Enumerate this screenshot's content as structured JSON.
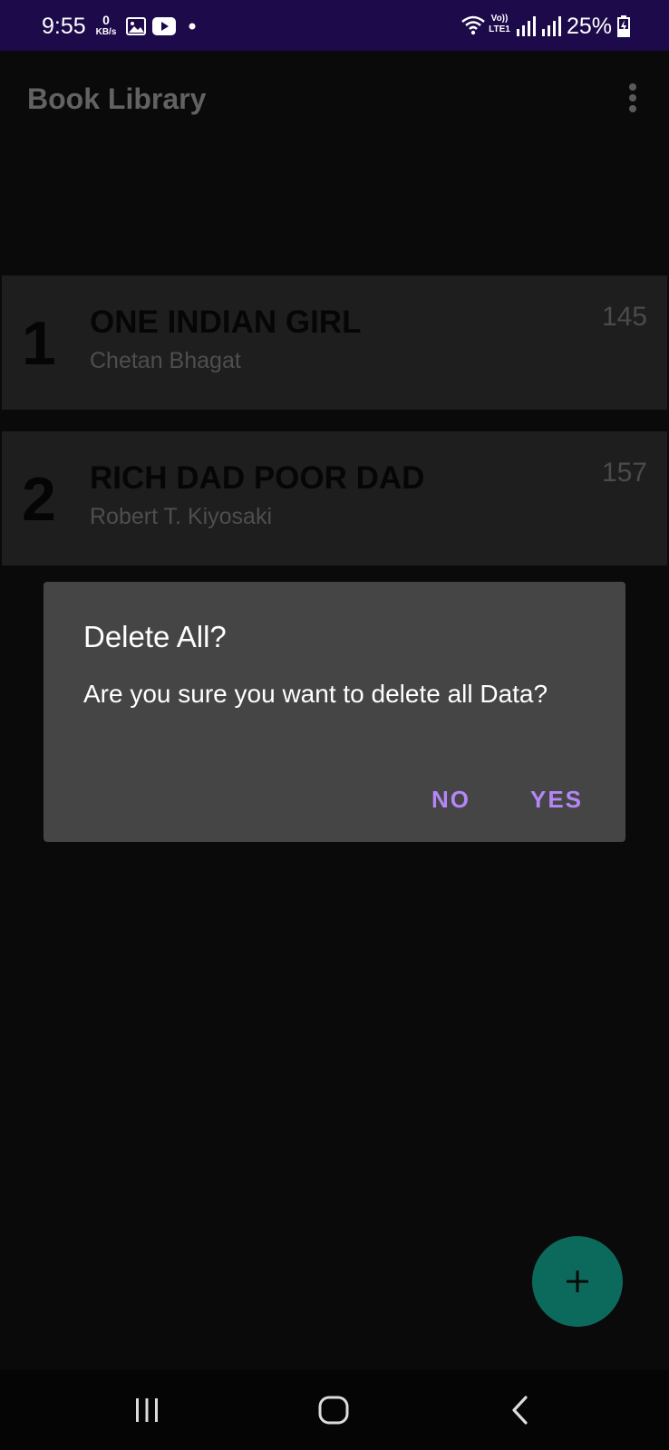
{
  "status_bar": {
    "time": "9:55",
    "network_speed_value": "0",
    "network_speed_unit": "KB/s",
    "network_label_top": "Vo))",
    "network_label_bottom": "LTE1",
    "battery": "25%",
    "icons": [
      "gallery-icon",
      "youtube-icon",
      "notification-dot-icon",
      "wifi-icon",
      "signal-icon",
      "battery-charging-icon"
    ]
  },
  "app_bar": {
    "title": "Book Library",
    "menu_icon": "more-vert-icon"
  },
  "books": [
    {
      "number": "1",
      "title": "ONE INDIAN GIRL",
      "author": "Chetan Bhagat",
      "pages": "145"
    },
    {
      "number": "2",
      "title": "RICH DAD POOR DAD",
      "author": "Robert T. Kiyosaki",
      "pages": "157"
    }
  ],
  "dialog": {
    "title": "Delete All?",
    "message": "Are you sure you want to delete all Data?",
    "negative_button": "NO",
    "positive_button": "YES"
  },
  "fab": {
    "icon": "add-icon"
  },
  "nav_bar": {
    "icons": [
      "recent-apps-icon",
      "home-icon",
      "back-icon"
    ]
  },
  "colors": {
    "status_bar": "#1c0a4a",
    "background": "#0a0a0a",
    "card": "#1e1e1e",
    "dialog": "#454545",
    "accent": "#b486f6",
    "fab": "#0c6a5d"
  }
}
